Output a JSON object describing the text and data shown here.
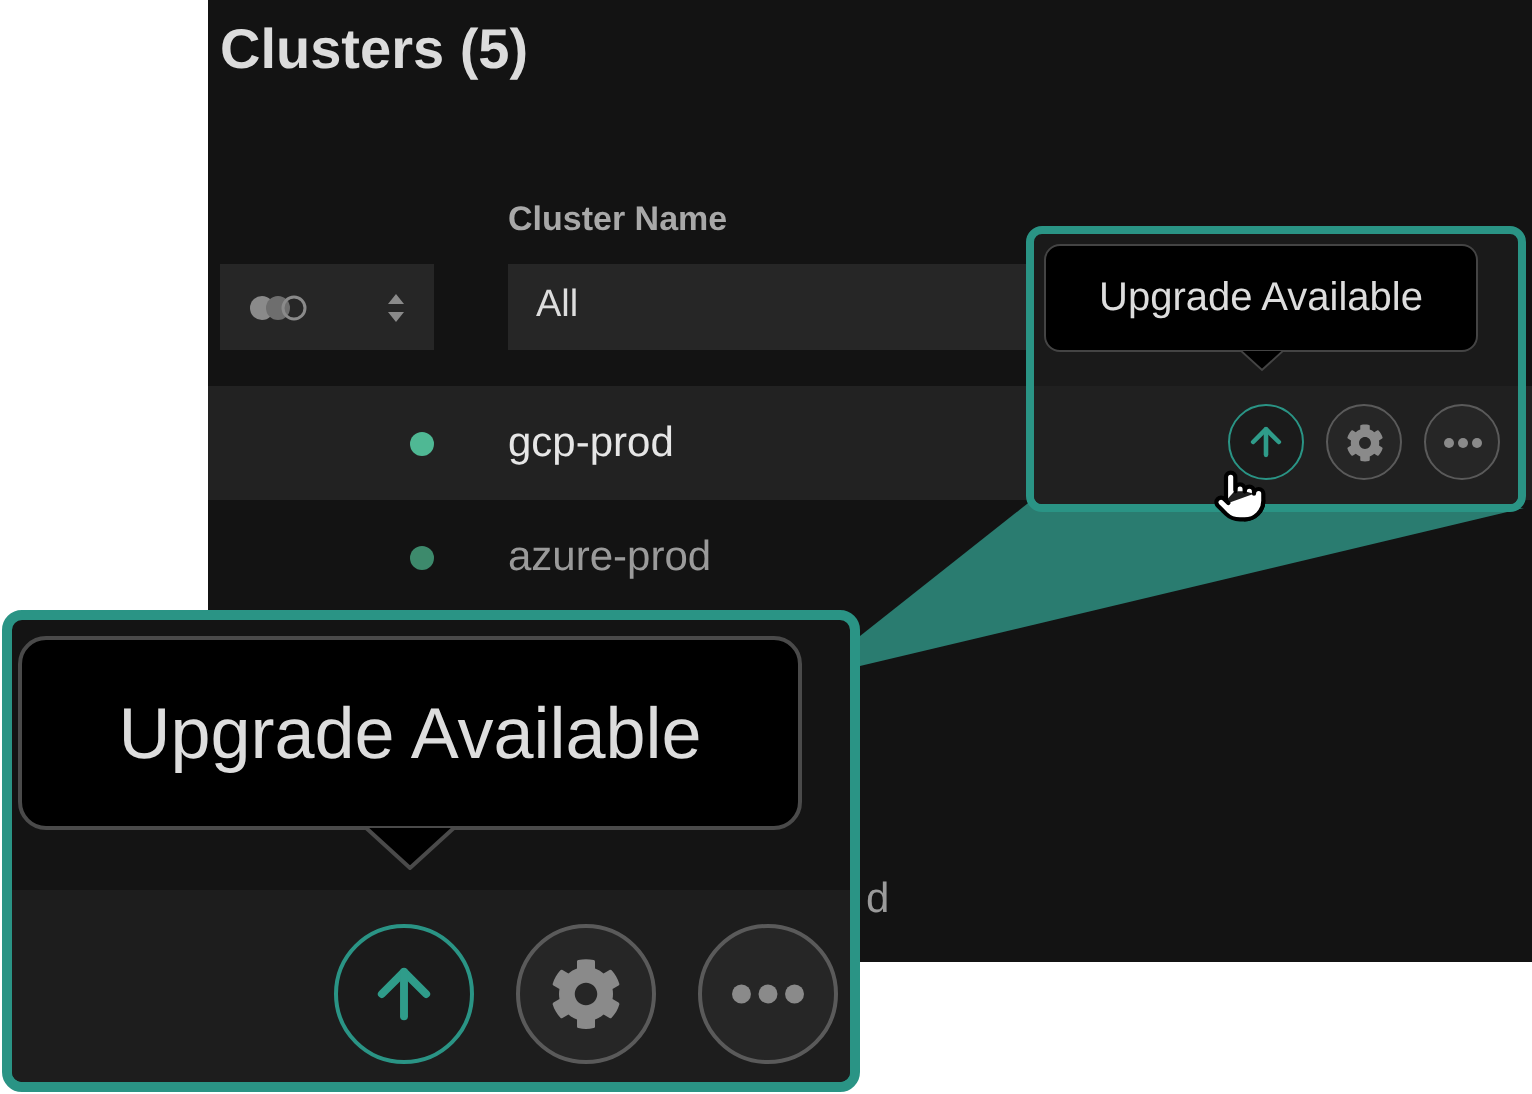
{
  "title": "Clusters (5)",
  "table": {
    "columns": [
      "Cluster Name"
    ],
    "filter": {
      "value": "All"
    },
    "rows": [
      {
        "kind": "row",
        "name": "gcp-prod",
        "selected": true,
        "color": "#4fb894"
      },
      {
        "kind": "row",
        "name": "azure-prod",
        "selected": false,
        "color": "#3d8a6c"
      },
      {
        "kind": "partial",
        "name": "d",
        "selected": false
      }
    ]
  },
  "actions": [
    {
      "kind": "upgrade",
      "highlighted": true
    },
    {
      "kind": "settings",
      "highlighted": false
    },
    {
      "kind": "more",
      "highlighted": false
    }
  ],
  "callout": {
    "tooltip": "Upgrade Available"
  },
  "magnified": {
    "tooltip": "Upgrade Available"
  }
}
